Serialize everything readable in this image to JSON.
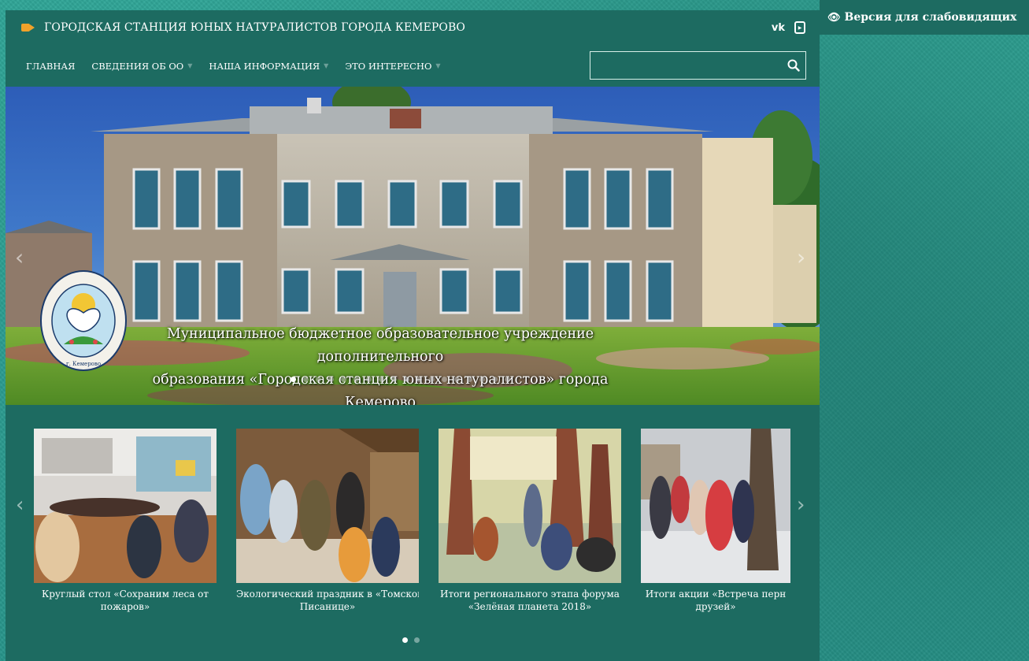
{
  "header": {
    "title": "ГОРОДСКАЯ СТАНЦИЯ ЮНЫХ НАТУРАЛИСТОВ ГОРОДА КЕМЕРОВО",
    "social": {
      "vk": "vk",
      "youtube": "You Tube"
    }
  },
  "accessibility": {
    "label": "Версия для слабовидящих",
    "icon": "eye-icon"
  },
  "nav": {
    "items": [
      {
        "label": "ГЛАВНАЯ",
        "has_dropdown": false
      },
      {
        "label": "СВЕДЕНИЯ ОБ ОО",
        "has_dropdown": true
      },
      {
        "label": "НАША ИНФОРМАЦИЯ",
        "has_dropdown": true
      },
      {
        "label": "ЭТО ИНТЕРЕСНО",
        "has_dropdown": true
      }
    ],
    "search": {
      "value": "",
      "placeholder": ""
    }
  },
  "hero": {
    "caption_line1": "Муниципальное бюджетное образовательное учреждение дополнительного",
    "caption_line2": "образования «Городская станция юных натуралистов» города Кемерово",
    "logo_text_top": "ГОРОДСКАЯ СТАНЦИЯ ЮНЫХ НАТУРАЛИСТОВ",
    "logo_text_bottom": "г. Кемерово",
    "slide_count": 18,
    "active_slide": 1
  },
  "news": {
    "cards": [
      {
        "line1": "Круглый стол «Сохраним леса от",
        "line2": "пожаров»"
      },
      {
        "line1": "Экологический праздник в «Томской",
        "line2": "Писанице»"
      },
      {
        "line1": "Итоги регионального этапа форума",
        "line2": "«Зелёная планета 2018»"
      },
      {
        "line1": "Итоги акции «Встреча перн",
        "line2": "друзей»"
      }
    ],
    "page_count": 2,
    "active_page": 1
  },
  "colors": {
    "panel": "#1d6b61",
    "background": "#2a9a8e",
    "accent_orange": "#f0a22a"
  }
}
